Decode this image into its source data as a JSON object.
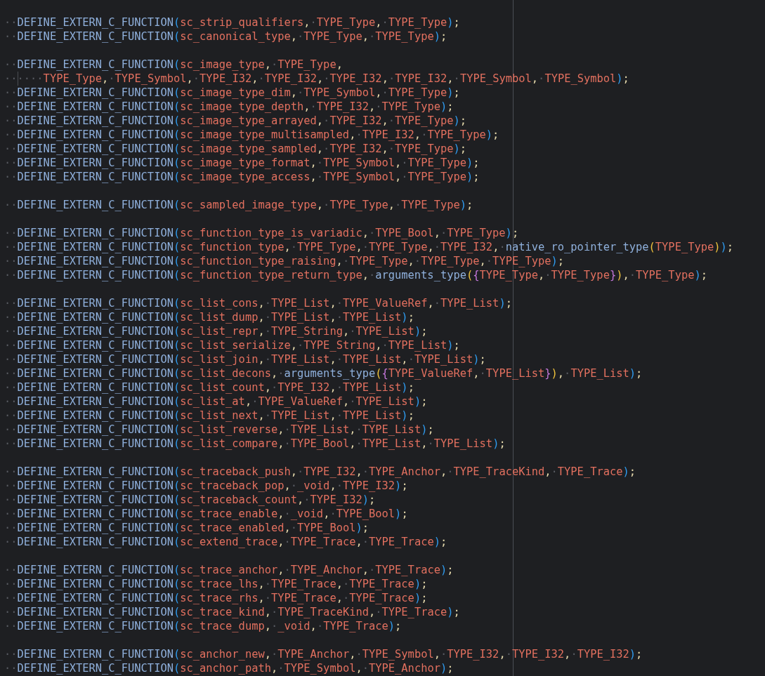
{
  "editor": {
    "lines": [
      {
        "kind": "code",
        "text": "··DEFINE_EXTERN_C_FUNCTION(sc_strip_qualifiers,·TYPE_Type,·TYPE_Type);"
      },
      {
        "kind": "code",
        "text": "··DEFINE_EXTERN_C_FUNCTION(sc_canonical_type,·TYPE_Type,·TYPE_Type);"
      },
      {
        "kind": "blank"
      },
      {
        "kind": "code",
        "text": "··DEFINE_EXTERN_C_FUNCTION(sc_image_type,·TYPE_Type,"
      },
      {
        "kind": "code",
        "indent_guide": true,
        "text": "······TYPE_Type,·TYPE_Symbol,·TYPE_I32,·TYPE_I32,·TYPE_I32,·TYPE_I32,·TYPE_Symbol,·TYPE_Symbol);"
      },
      {
        "kind": "code",
        "text": "··DEFINE_EXTERN_C_FUNCTION(sc_image_type_dim,·TYPE_Symbol,·TYPE_Type);"
      },
      {
        "kind": "code",
        "text": "··DEFINE_EXTERN_C_FUNCTION(sc_image_type_depth,·TYPE_I32,·TYPE_Type);"
      },
      {
        "kind": "code",
        "text": "··DEFINE_EXTERN_C_FUNCTION(sc_image_type_arrayed,·TYPE_I32,·TYPE_Type);"
      },
      {
        "kind": "code",
        "text": "··DEFINE_EXTERN_C_FUNCTION(sc_image_type_multisampled,·TYPE_I32,·TYPE_Type);"
      },
      {
        "kind": "code",
        "text": "··DEFINE_EXTERN_C_FUNCTION(sc_image_type_sampled,·TYPE_I32,·TYPE_Type);"
      },
      {
        "kind": "code",
        "text": "··DEFINE_EXTERN_C_FUNCTION(sc_image_type_format,·TYPE_Symbol,·TYPE_Type);"
      },
      {
        "kind": "code",
        "text": "··DEFINE_EXTERN_C_FUNCTION(sc_image_type_access,·TYPE_Symbol,·TYPE_Type);"
      },
      {
        "kind": "blank"
      },
      {
        "kind": "code",
        "text": "··DEFINE_EXTERN_C_FUNCTION(sc_sampled_image_type,·TYPE_Type,·TYPE_Type);"
      },
      {
        "kind": "blank"
      },
      {
        "kind": "code",
        "text": "··DEFINE_EXTERN_C_FUNCTION(sc_function_type_is_variadic,·TYPE_Bool,·TYPE_Type);"
      },
      {
        "kind": "code",
        "text": "··DEFINE_EXTERN_C_FUNCTION(sc_function_type,·TYPE_Type,·TYPE_Type,·TYPE_I32,·native_ro_pointer_type(TYPE_Type));"
      },
      {
        "kind": "code",
        "text": "··DEFINE_EXTERN_C_FUNCTION(sc_function_type_raising,·TYPE_Type,·TYPE_Type,·TYPE_Type);"
      },
      {
        "kind": "code",
        "text": "··DEFINE_EXTERN_C_FUNCTION(sc_function_type_return_type,·arguments_type({TYPE_Type,·TYPE_Type}),·TYPE_Type);"
      },
      {
        "kind": "blank"
      },
      {
        "kind": "code",
        "text": "··DEFINE_EXTERN_C_FUNCTION(sc_list_cons,·TYPE_List,·TYPE_ValueRef,·TYPE_List);"
      },
      {
        "kind": "code",
        "text": "··DEFINE_EXTERN_C_FUNCTION(sc_list_dump,·TYPE_List,·TYPE_List);"
      },
      {
        "kind": "code",
        "text": "··DEFINE_EXTERN_C_FUNCTION(sc_list_repr,·TYPE_String,·TYPE_List);"
      },
      {
        "kind": "code",
        "text": "··DEFINE_EXTERN_C_FUNCTION(sc_list_serialize,·TYPE_String,·TYPE_List);"
      },
      {
        "kind": "code",
        "text": "··DEFINE_EXTERN_C_FUNCTION(sc_list_join,·TYPE_List,·TYPE_List,·TYPE_List);"
      },
      {
        "kind": "code",
        "text": "··DEFINE_EXTERN_C_FUNCTION(sc_list_decons,·arguments_type({TYPE_ValueRef,·TYPE_List}),·TYPE_List);"
      },
      {
        "kind": "code",
        "text": "··DEFINE_EXTERN_C_FUNCTION(sc_list_count,·TYPE_I32,·TYPE_List);"
      },
      {
        "kind": "code",
        "text": "··DEFINE_EXTERN_C_FUNCTION(sc_list_at,·TYPE_ValueRef,·TYPE_List);"
      },
      {
        "kind": "code",
        "text": "··DEFINE_EXTERN_C_FUNCTION(sc_list_next,·TYPE_List,·TYPE_List);"
      },
      {
        "kind": "code",
        "text": "··DEFINE_EXTERN_C_FUNCTION(sc_list_reverse,·TYPE_List,·TYPE_List);"
      },
      {
        "kind": "code",
        "text": "··DEFINE_EXTERN_C_FUNCTION(sc_list_compare,·TYPE_Bool,·TYPE_List,·TYPE_List);"
      },
      {
        "kind": "blank"
      },
      {
        "kind": "code",
        "text": "··DEFINE_EXTERN_C_FUNCTION(sc_traceback_push,·TYPE_I32,·TYPE_Anchor,·TYPE_TraceKind,·TYPE_Trace);"
      },
      {
        "kind": "code",
        "text": "··DEFINE_EXTERN_C_FUNCTION(sc_traceback_pop,·_void,·TYPE_I32);"
      },
      {
        "kind": "code",
        "text": "··DEFINE_EXTERN_C_FUNCTION(sc_traceback_count,·TYPE_I32);"
      },
      {
        "kind": "code",
        "text": "··DEFINE_EXTERN_C_FUNCTION(sc_trace_enable,·_void,·TYPE_Bool);"
      },
      {
        "kind": "code",
        "text": "··DEFINE_EXTERN_C_FUNCTION(sc_trace_enabled,·TYPE_Bool);"
      },
      {
        "kind": "code",
        "text": "··DEFINE_EXTERN_C_FUNCTION(sc_extend_trace,·TYPE_Trace,·TYPE_Trace);"
      },
      {
        "kind": "blank"
      },
      {
        "kind": "code",
        "text": "··DEFINE_EXTERN_C_FUNCTION(sc_trace_anchor,·TYPE_Anchor,·TYPE_Trace);"
      },
      {
        "kind": "code",
        "text": "··DEFINE_EXTERN_C_FUNCTION(sc_trace_lhs,·TYPE_Trace,·TYPE_Trace);"
      },
      {
        "kind": "code",
        "text": "··DEFINE_EXTERN_C_FUNCTION(sc_trace_rhs,·TYPE_Trace,·TYPE_Trace);"
      },
      {
        "kind": "code",
        "text": "··DEFINE_EXTERN_C_FUNCTION(sc_trace_kind,·TYPE_TraceKind,·TYPE_Trace);"
      },
      {
        "kind": "code",
        "text": "··DEFINE_EXTERN_C_FUNCTION(sc_trace_dump,·_void,·TYPE_Trace);"
      },
      {
        "kind": "blank"
      },
      {
        "kind": "code",
        "text": "··DEFINE_EXTERN_C_FUNCTION(sc_anchor_new,·TYPE_Anchor,·TYPE_Symbol,·TYPE_I32,·TYPE_I32,·TYPE_I32);"
      },
      {
        "kind": "code",
        "text": "··DEFINE_EXTERN_C_FUNCTION(sc_anchor_path,·TYPE_Symbol,·TYPE_Anchor);"
      }
    ]
  }
}
